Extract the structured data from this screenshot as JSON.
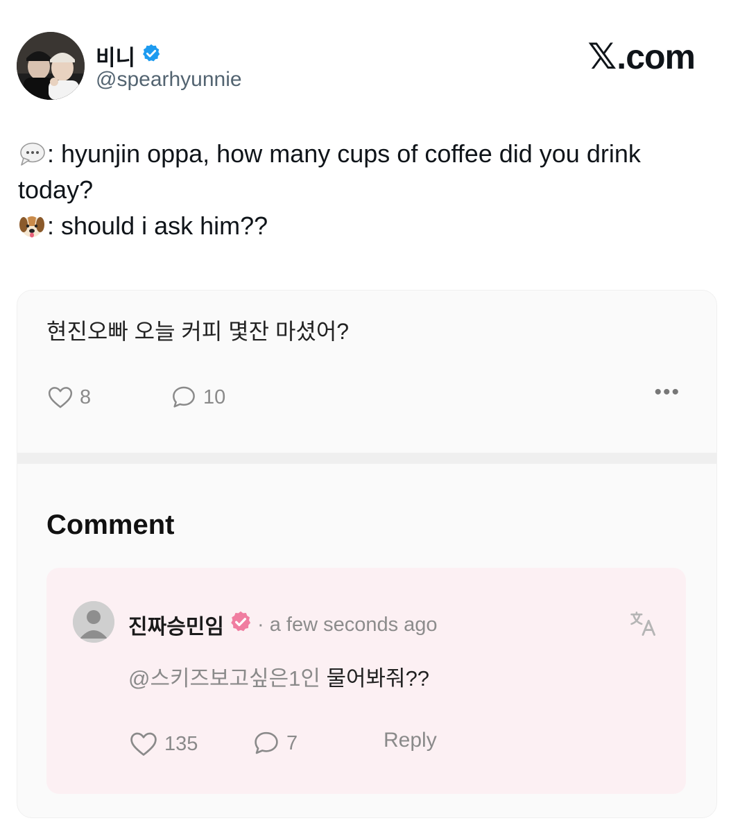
{
  "header": {
    "display_name": "비니",
    "handle": "@spearhyunnie",
    "site_x": "𝕏",
    "site_suffix": ".com"
  },
  "tweet": {
    "line1_text": ": hyunjin oppa, how many cups of coffee did you drink today?",
    "line2_text": ": should i ask him??",
    "line1_emoji": "speech-bubble",
    "line2_emoji": "dog-face"
  },
  "card": {
    "post_text": "현진오빠 오늘 커피 몇잔 마셨어?",
    "likes": "8",
    "comments": "10",
    "more": "•••",
    "section_title": "Comment",
    "comment": {
      "author": "진짜승민임",
      "time": "· a few seconds ago",
      "mention": "@스키즈보고싶은1인",
      "text": " 물어봐줘??",
      "likes": "135",
      "replies": "7",
      "reply_label": "Reply"
    }
  },
  "colors": {
    "verified_blue": "#1d9bf0",
    "verified_pink": "#f07da0",
    "comment_bg": "#fcf0f3",
    "muted": "#8a8a8a"
  }
}
